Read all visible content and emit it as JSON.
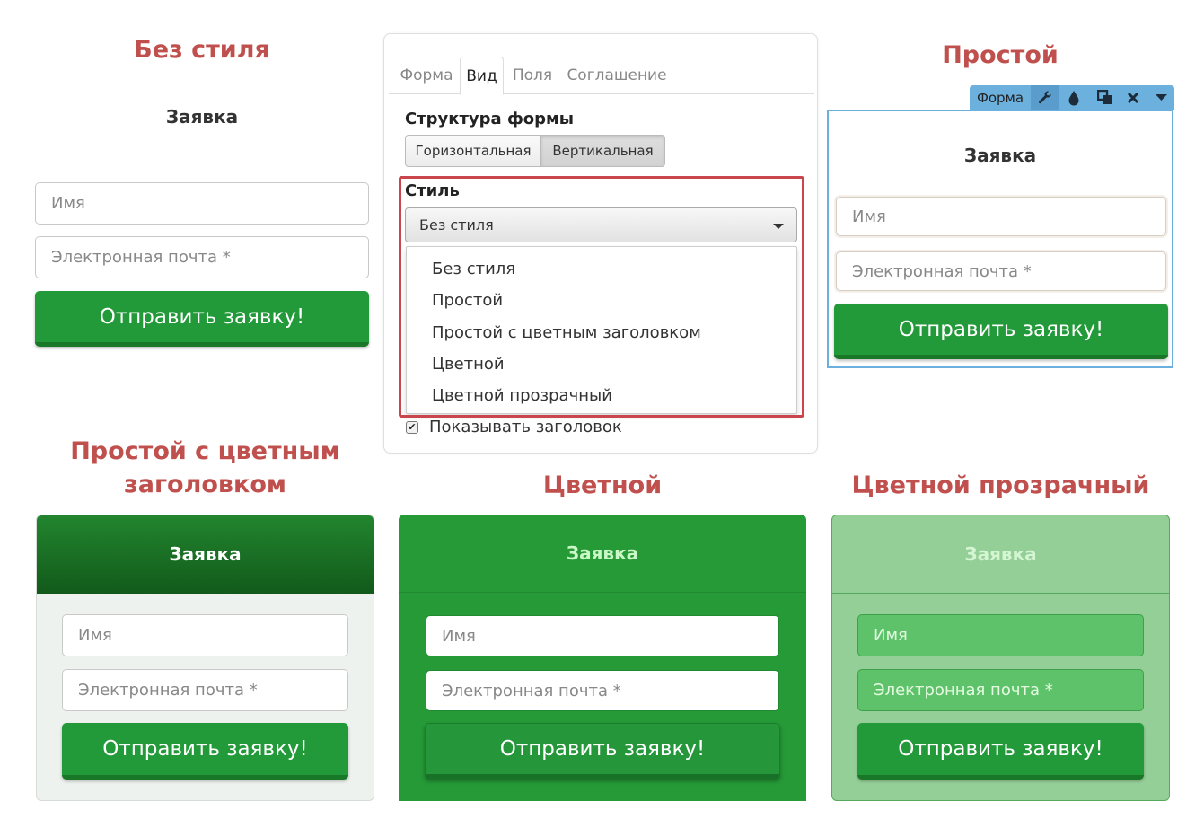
{
  "captions": {
    "no_style": "Без стиля",
    "simple": "Простой",
    "colored_header_line1": "Простой с цветным",
    "colored_header_line2": "заголовком",
    "colored": "Цветной",
    "transparent": "Цветной прозрачный"
  },
  "form": {
    "title": "Заявка",
    "name_placeholder": "Имя",
    "email_placeholder": "Электронная почта *",
    "submit_label": "Отправить заявку!"
  },
  "panel": {
    "tabs": [
      "Форма",
      "Вид",
      "Поля",
      "Соглашение"
    ],
    "active_tab": "Вид",
    "structure_label": "Структура формы",
    "structure_options": [
      "Горизонтальная",
      "Вертикальная"
    ],
    "structure_selected": "Вертикальная",
    "style_label": "Стиль",
    "style_selected": "Без стиля",
    "style_options": [
      "Без стиля",
      "Простой",
      "Простой с цветным заголовком",
      "Цветной",
      "Цветной прозрачный"
    ],
    "show_title_label": "Показывать заголовок",
    "show_title_checked": true
  },
  "toolbar": {
    "label": "Форма",
    "icons": [
      "wrench-icon",
      "drop-icon",
      "duplicate-icon",
      "close-icon",
      "caret-down-icon"
    ]
  },
  "colors": {
    "accent_green": "#239a39",
    "dark_green_header": "#15641f",
    "caption_red": "#c0504d",
    "toolbar_blue": "#6cb0dd"
  }
}
